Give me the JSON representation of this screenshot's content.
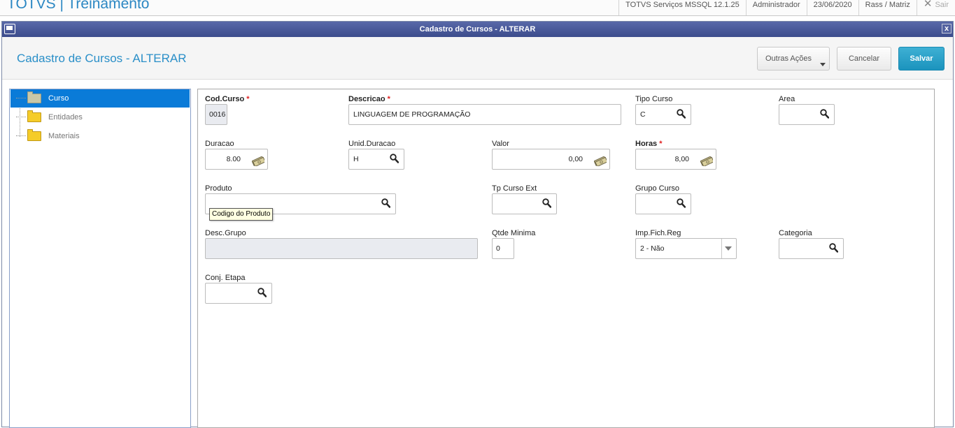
{
  "topbar": {
    "app_title": "TOTVS | Treinamento",
    "server": "TOTVS Serviços MSSQL 12.1.25",
    "user": "Administrador",
    "date": "23/06/2020",
    "branch": "Rass / Matriz",
    "logout": "Sair"
  },
  "window": {
    "title": "Cadastro de Cursos - ALTERAR",
    "close": "x"
  },
  "header": {
    "title": "Cadastro de Cursos - ALTERAR",
    "buttons": {
      "other_actions": "Outras Ações",
      "cancel": "Cancelar",
      "save": "Salvar"
    }
  },
  "tree": {
    "items": [
      {
        "label": "Curso",
        "selected": true
      },
      {
        "label": "Entidades",
        "selected": false
      },
      {
        "label": "Materiais",
        "selected": false
      }
    ]
  },
  "form": {
    "cod_curso": {
      "label": "Cod.Curso",
      "required": "*",
      "value": "0016"
    },
    "descricao": {
      "label": "Descricao",
      "required": "*",
      "value": "LINGUAGEM DE PROGRAMAÇÃO"
    },
    "tipo_curso": {
      "label": "Tipo Curso",
      "value": "C"
    },
    "area": {
      "label": "Area",
      "value": ""
    },
    "duracao": {
      "label": "Duracao",
      "value": "8.00"
    },
    "unid_duracao": {
      "label": "Unid.Duracao",
      "value": "H"
    },
    "valor": {
      "label": "Valor",
      "value": "0,00"
    },
    "horas": {
      "label": "Horas",
      "required": "*",
      "value": "8,00"
    },
    "produto": {
      "label": "Produto",
      "value": "",
      "tooltip": "Codigo do Produto"
    },
    "tp_curso_ext": {
      "label": "Tp Curso Ext",
      "value": ""
    },
    "grupo_curso": {
      "label": "Grupo Curso",
      "value": ""
    },
    "desc_grupo": {
      "label": "Desc.Grupo",
      "value": ""
    },
    "qtde_minima": {
      "label": "Qtde Minima",
      "value": "0"
    },
    "imp_fich_reg": {
      "label": "Imp.Fich.Reg",
      "value": "2 - Não"
    },
    "categoria": {
      "label": "Categoria",
      "value": ""
    },
    "conj_etapa": {
      "label": "Conj. Etapa",
      "value": ""
    }
  },
  "colors": {
    "accent": "#2a8fc8",
    "save_button": "#1b93bd",
    "titlebar": "#4a5a9a",
    "tree_selected": "#0a7bd8",
    "required": "#e02020"
  },
  "icons": [
    "search-icon",
    "money-icon",
    "folder-icon",
    "close-icon",
    "chevron-down-icon",
    "window-icon"
  ]
}
